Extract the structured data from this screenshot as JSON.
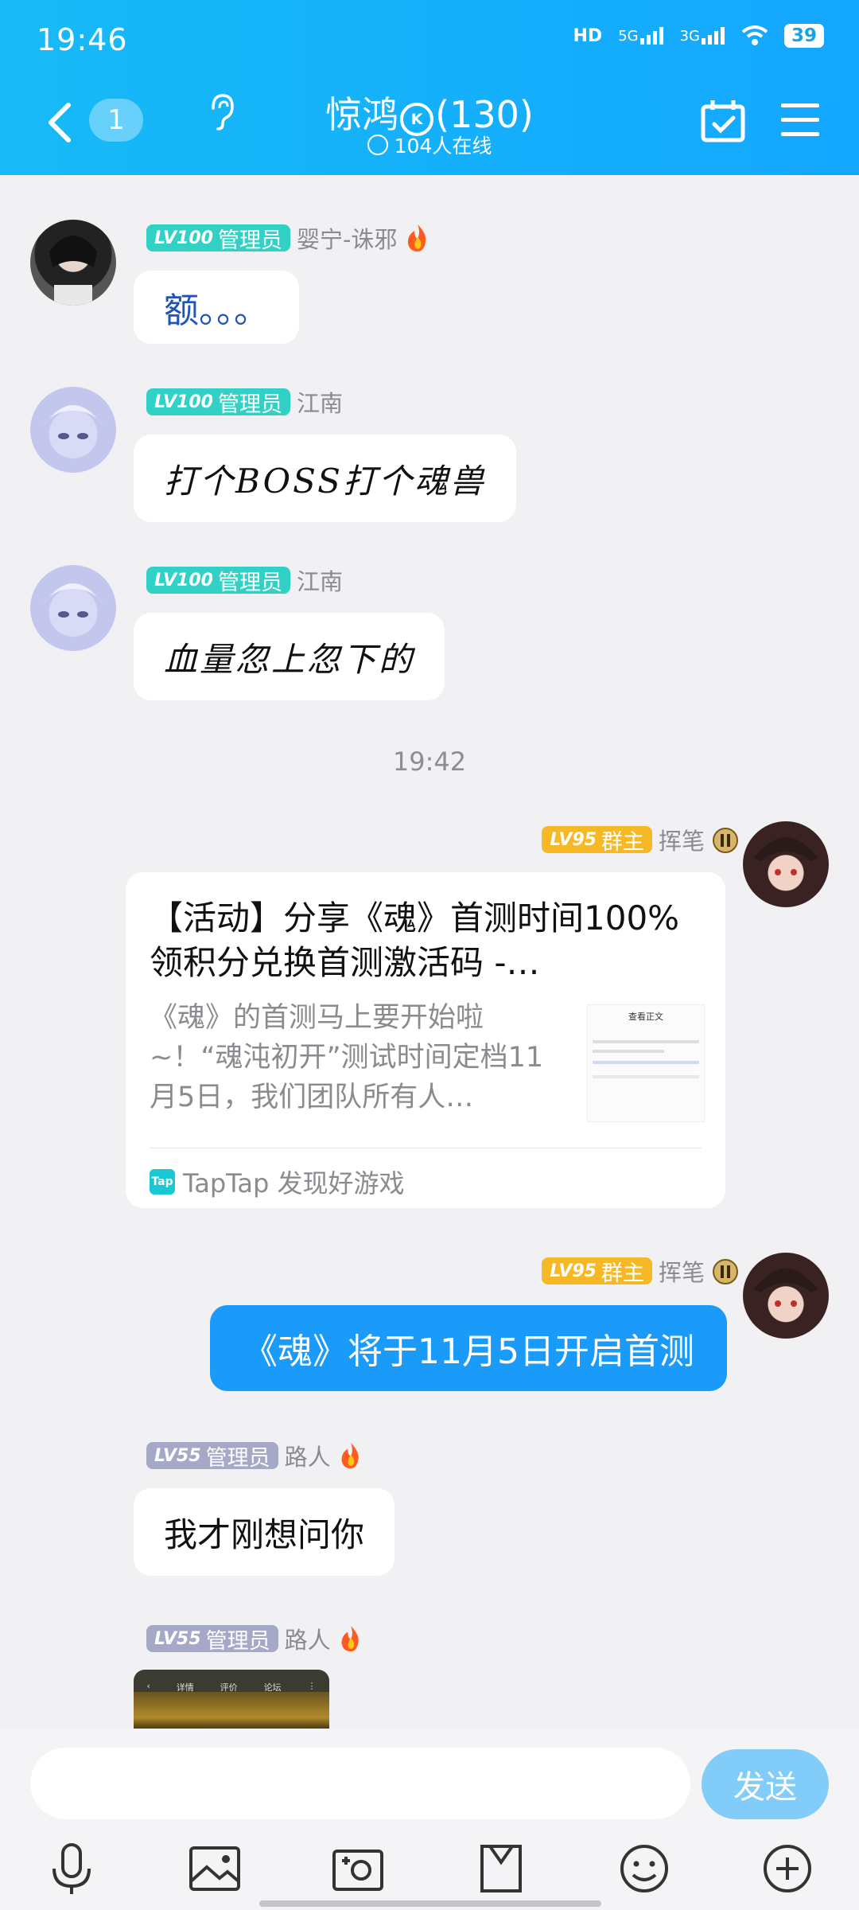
{
  "status_bar": {
    "time": "19:46",
    "net1": "HD",
    "net2": "5G",
    "net3": "3G",
    "battery": "39"
  },
  "header": {
    "unread_count": "1",
    "group_name": "惊鸿",
    "member_count": "(130)",
    "online_text": "104人在线"
  },
  "timestamp": "19:42",
  "messages": {
    "m1": {
      "level": "LV100",
      "role": "管理员",
      "name": "婴宁-诛邪",
      "text": "额。。。"
    },
    "m2": {
      "level": "LV100",
      "role": "管理员",
      "name": "江南",
      "text": "打个BOSS打个魂兽"
    },
    "m3": {
      "level": "LV100",
      "role": "管理员",
      "name": "江南",
      "text": "血量忽上忽下的"
    },
    "m4": {
      "level": "LV95",
      "role": "群主",
      "name": "挥笔",
      "card": {
        "title": "【活动】分享《魂》首测时间100%领积分兑换首测激活码 -…",
        "desc": "《魂》的首测马上要开始啦~！“魂沌初开”测试时间定档11月5日，我们团队所有人…",
        "thumb_title": "查看正文",
        "source": "TapTap 发现好游戏",
        "source_logo": "Tap"
      }
    },
    "m5": {
      "level": "LV95",
      "role": "群主",
      "name": "挥笔",
      "text": "《魂》将于11月5日开启首测"
    },
    "m6": {
      "level": "LV55",
      "role": "管理员",
      "name": "路人",
      "text": "我才刚想问你"
    },
    "m7": {
      "level": "LV55",
      "role": "管理员",
      "name": "路人",
      "image_tabs": [
        "详情",
        "评价",
        "论坛"
      ]
    }
  },
  "input": {
    "placeholder": "",
    "send_label": "发送"
  },
  "toolbar": [
    "mic-icon",
    "image-icon",
    "camera-icon",
    "file-icon",
    "emoji-icon",
    "plus-icon"
  ],
  "colors": {
    "header": "#13a7ff",
    "my_bubble": "#1a9af9",
    "send": "#82ccf9",
    "admin_badge": "#32d1c5",
    "owner_badge": "#f7b825",
    "low_badge": "#a5a9c7"
  }
}
